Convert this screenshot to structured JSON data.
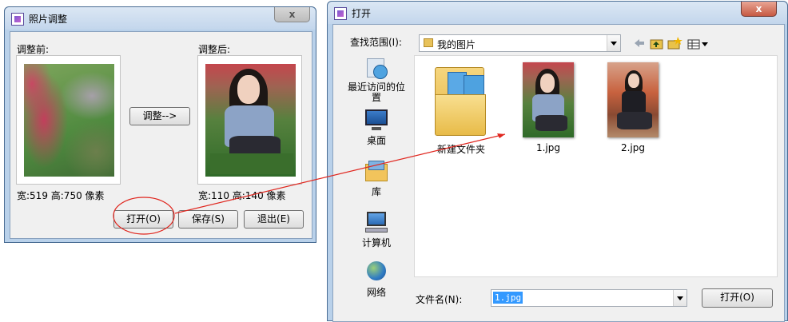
{
  "left_window": {
    "title": "照片调整",
    "close_glyph": "x",
    "before_label": "调整前:",
    "after_label": "调整后:",
    "adjust_button": "调整-->",
    "before_size": "宽:519 高:750 像素",
    "after_size": "宽:110 高:140 像素",
    "open_button": "打开(O)",
    "save_button": "保存(S)",
    "exit_button": "退出(E)"
  },
  "right_window": {
    "title": "打开",
    "close_glyph": "x",
    "lookin_label": "查找范围(I):",
    "lookin_value": "我的图片",
    "places": [
      {
        "label": "最近访问的位置",
        "icon": "recent-places-icon"
      },
      {
        "label": "桌面",
        "icon": "desktop-icon"
      },
      {
        "label": "库",
        "icon": "library-icon"
      },
      {
        "label": "计算机",
        "icon": "computer-icon"
      },
      {
        "label": "网络",
        "icon": "network-icon"
      }
    ],
    "files": [
      {
        "name": "新建文件夹",
        "type": "folder"
      },
      {
        "name": "1.jpg",
        "type": "image"
      },
      {
        "name": "2.jpg",
        "type": "image"
      }
    ],
    "filename_label": "文件名(N):",
    "filename_value": "1.jpg",
    "open_button": "打开(O)"
  },
  "colors": {
    "annotation": "#e0261e",
    "window_frame": "#b9d1ea",
    "selection": "#3399ff"
  }
}
